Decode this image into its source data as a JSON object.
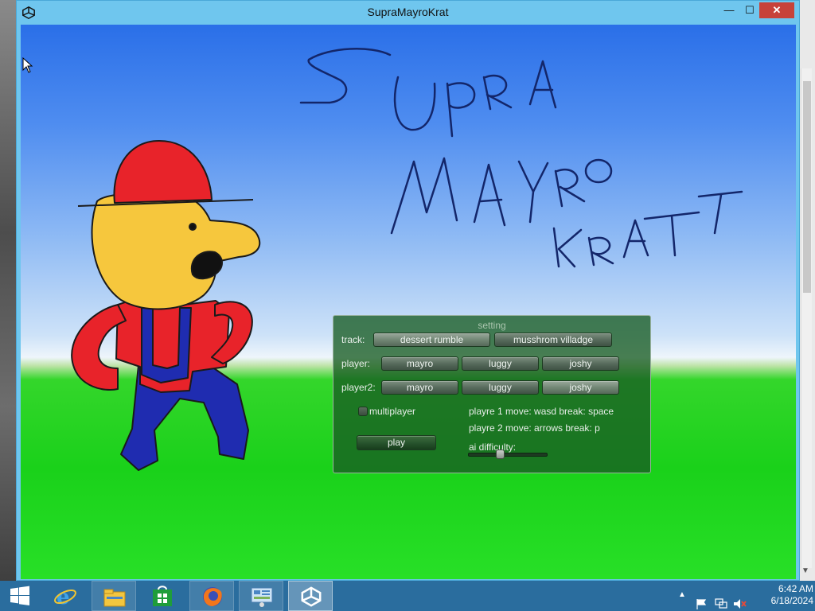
{
  "window": {
    "title": "SupraMayroKrat",
    "controls": {
      "minimize": "—",
      "maximize": "☐",
      "close": "✕"
    }
  },
  "settings": {
    "title": "setting",
    "track_label": "track:",
    "tracks": [
      "dessert rumble",
      "musshrom villadge"
    ],
    "player_label": "player:",
    "player2_label": "player2:",
    "characters": [
      "mayro",
      "luggy",
      "joshy"
    ],
    "player2_selected": "joshy",
    "multiplayer_label": "multiplayer",
    "multiplayer_checked": false,
    "play_label": "play",
    "controls_p1": "playre 1 move: wasd break: space",
    "controls_p2": "playre 2 move: arrows break: p",
    "ai_difficulty_label": "ai difficulty:",
    "ai_difficulty_value": 0.4
  },
  "taskbar": {
    "apps": [
      "start-icon",
      "internet-explorer-icon",
      "file-explorer-icon",
      "store-icon",
      "firefox-icon",
      "control-panel-icon",
      "unity-icon"
    ],
    "clock_time": "6:42 AM",
    "clock_date": "6/18/2024"
  },
  "colors": {
    "title_bar": "#6fc6ee",
    "close_button": "#c7423a",
    "panel": "#185c22",
    "taskbar": "#2a6d9e",
    "hat": "#e8232a",
    "skin": "#f6c73d",
    "overalls": "#1f2cb0"
  }
}
